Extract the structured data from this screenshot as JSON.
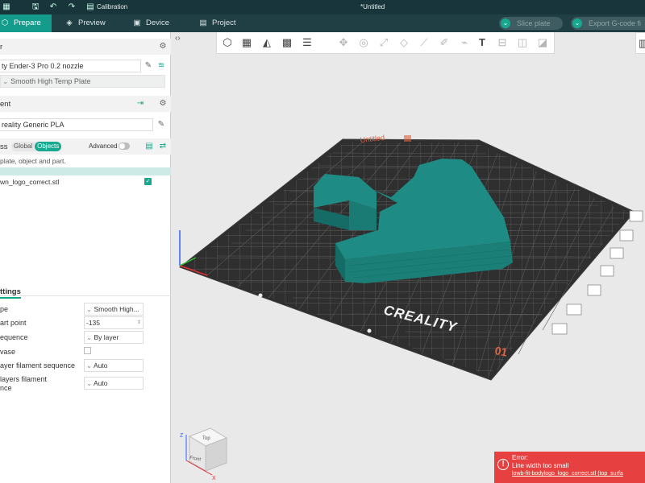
{
  "titlebar": {
    "calibration_label": "Calibration",
    "document_title": "*Untitled"
  },
  "tabs": [
    {
      "label": "Prepare",
      "icon": "cube-icon"
    },
    {
      "label": "Preview",
      "icon": "layers-icon"
    },
    {
      "label": "Device",
      "icon": "monitor-icon"
    },
    {
      "label": "Project",
      "icon": "project-icon"
    }
  ],
  "actions": {
    "slice_label": "Slice plate",
    "export_label": "Export G-code fi"
  },
  "printer": {
    "section_title": "r",
    "name": "ty Ender-3 Pro 0.2 nozzle",
    "plate_label": "Smooth High Temp Plate"
  },
  "filament": {
    "section_title": "ent",
    "name": "reality Generic PLA"
  },
  "process": {
    "section_title": "ss",
    "global_label": "Global",
    "objects_label": "Objects",
    "advanced_label": "Advanced",
    "hint": "plate, object and part.",
    "object_name": "wn_logo_correct.stl"
  },
  "settings": {
    "heading": "ttings",
    "rows": [
      {
        "label": "pe",
        "value": "Smooth High..."
      },
      {
        "label": "art point",
        "value": "-135"
      },
      {
        "label": "equence",
        "value": "By layer"
      },
      {
        "label": "vase",
        "value": ""
      },
      {
        "label": "ayer filament sequence",
        "value": "Auto"
      },
      {
        "label": "layers filament",
        "label2": "nce",
        "value": "Auto"
      }
    ]
  },
  "viewport": {
    "plate_name": "Untitled",
    "brand": "CREALITY",
    "plate_number": "01",
    "cube_top": "Top",
    "cube_front": "Front",
    "axis_z": "Z",
    "axis_x": "X"
  },
  "error": {
    "title": "Error:",
    "message": "Line width too small",
    "link": "lowb-fit-bodylogo_logo_correct.stl (top_surfa"
  },
  "colors": {
    "teal_accent": "#17a98f",
    "model": "#1e8c84",
    "error": "#e64040"
  }
}
